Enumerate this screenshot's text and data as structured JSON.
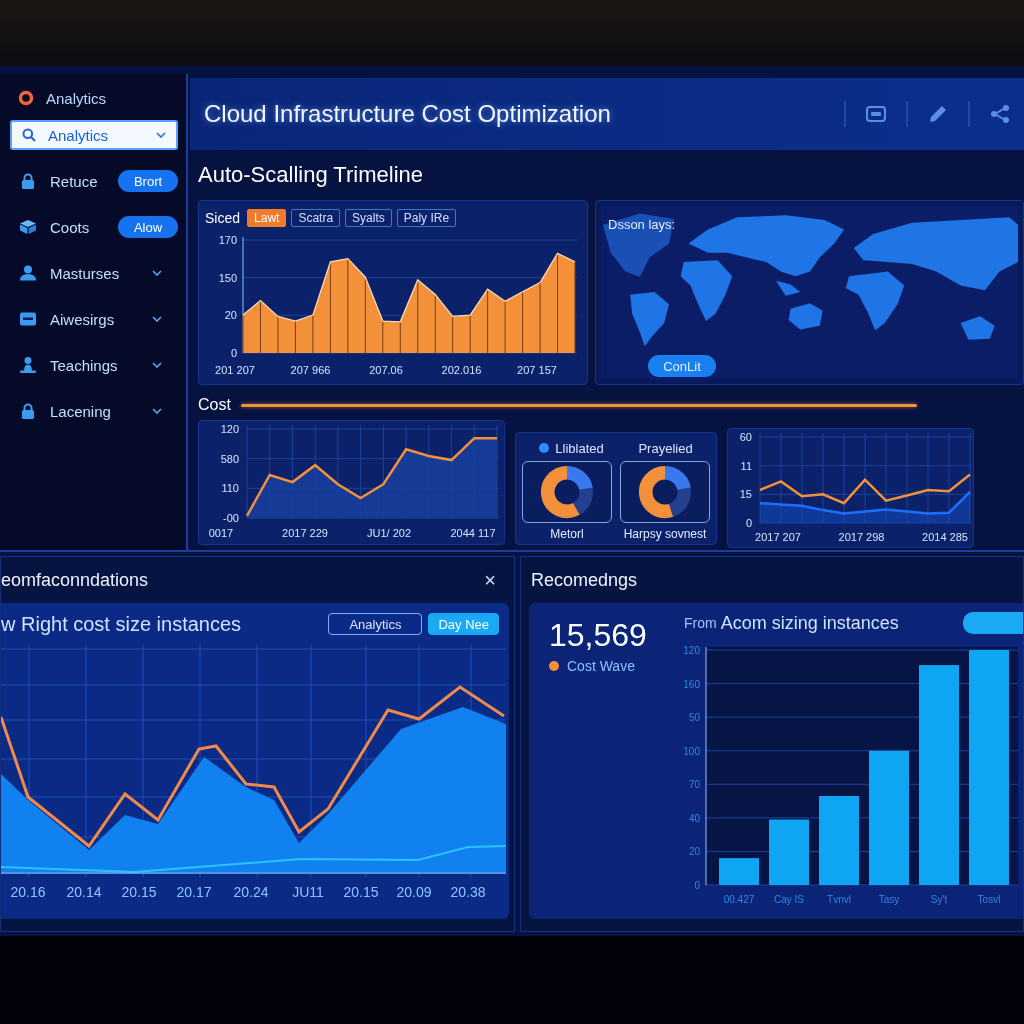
{
  "sidebar": {
    "title": "Analytics",
    "search": {
      "value": "Analytics"
    },
    "items": [
      {
        "kind": "action",
        "label": "Retuce",
        "action": "Brort"
      },
      {
        "kind": "action",
        "label": "Coots",
        "action": "Alow"
      },
      {
        "kind": "menu",
        "label": "Masturses"
      },
      {
        "kind": "menu",
        "label": "Aiwesirgs"
      },
      {
        "kind": "menu",
        "label": "Teachings"
      },
      {
        "kind": "menu",
        "label": "Lacening"
      }
    ]
  },
  "header": {
    "title": "Cloud Infrastructure Cost Optimization"
  },
  "timeline": {
    "heading": "Auto-Scalling Trimeline",
    "legend_label": "Siced",
    "tabs": [
      {
        "label": "Lawt",
        "selected": true
      },
      {
        "label": "Scatra",
        "selected": false
      },
      {
        "label": "Syalts",
        "selected": false
      },
      {
        "label": "Paly IRe",
        "selected": false
      }
    ],
    "y_labels": [
      "170",
      "150",
      "20",
      "0"
    ],
    "x_labels": [
      "201 207",
      "207 966",
      "207.06",
      "202.016",
      "207 157"
    ]
  },
  "map": {
    "label": "Dsson lays:",
    "button": "ConLit"
  },
  "cost": {
    "title": "Cost",
    "y_labels": [
      "120",
      "580",
      "110",
      "-00"
    ],
    "x_labels": [
      "0017",
      "2017 229",
      "JU1/ 202",
      "2044 117"
    ]
  },
  "gauges": {
    "legend": [
      {
        "label": "Lliblated",
        "color": "#2f8cff"
      },
      {
        "label": "Prayelied"
      }
    ],
    "items": [
      {
        "label": "Metorl"
      },
      {
        "label": "Harpsy sovnest"
      }
    ]
  },
  "trend": {
    "y_labels": [
      "60",
      "11",
      "15",
      "0"
    ],
    "x_labels": [
      "2017 207",
      "2017 298",
      "2014 285"
    ]
  },
  "recommendations": {
    "title": "eomfaconndations",
    "close": "×",
    "heading": "w Right cost size instances",
    "buttons": [
      {
        "label": "Analytics",
        "selected": false
      },
      {
        "label": "Day Nee",
        "selected": true
      }
    ],
    "x_labels": [
      "20.16",
      "20.14",
      "20.15",
      "20.17",
      "20.24",
      "JU11",
      "20.15",
      "20.09",
      "20.38"
    ]
  },
  "recommendings": {
    "title": "Recomedngs",
    "total": "15,569",
    "total_label": "Cost Wave",
    "chart_prefix": "From",
    "chart_title": "Acom sizing instances",
    "y_labels": [
      "120",
      "160",
      "50",
      "100",
      "70",
      "40",
      "20",
      "0"
    ],
    "x_labels": [
      "00.427",
      "Cay IS",
      "Tvnvl",
      "Tasy",
      "Sy't",
      "Tosvl"
    ]
  }
}
